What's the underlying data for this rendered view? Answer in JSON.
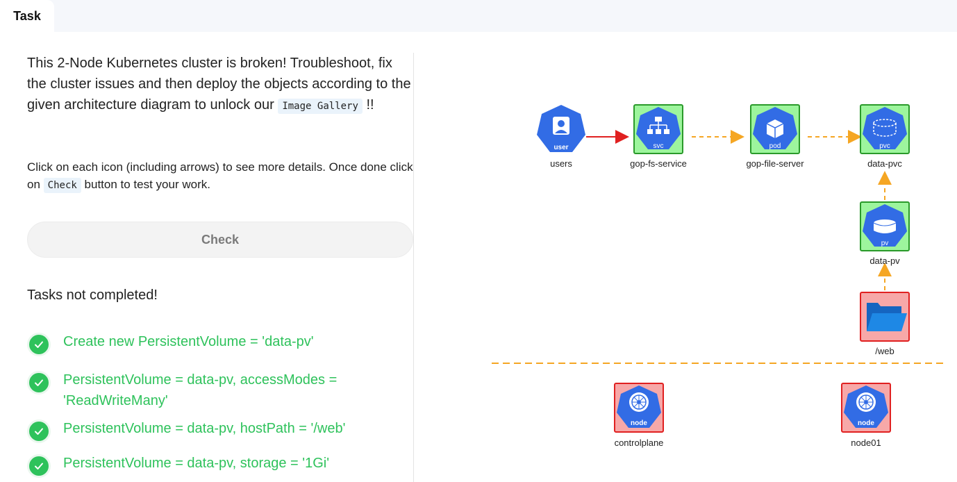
{
  "tab": {
    "label": "Task"
  },
  "intro": {
    "text": "This 2-Node Kubernetes cluster is broken! Troubleshoot, fix the cluster issues and then deploy the objects according to the given architecture diagram to unlock our",
    "code": "Image Gallery",
    "suffix": "!!"
  },
  "instructions": {
    "prefix": "Click on each icon (including arrows) to see more details. Once done click on",
    "code": "Check",
    "suffix": "button to test your work."
  },
  "check_button": {
    "label": "Check"
  },
  "status": {
    "text": "Tasks not completed!"
  },
  "tasks": [
    {
      "label": "Create new PersistentVolume = 'data-pv'",
      "done": true
    },
    {
      "label": "PersistentVolume = data-pv, accessModes = 'ReadWriteMany'",
      "done": true
    },
    {
      "label": "PersistentVolume = data-pv, hostPath = '/web'",
      "done": true
    },
    {
      "label": "PersistentVolume = data-pv, storage = '1Gi'",
      "done": true
    }
  ],
  "diagram": {
    "nodes": [
      {
        "id": "users",
        "label": "users",
        "badge": "user",
        "icon": "user-icon",
        "status": "none"
      },
      {
        "id": "svc",
        "label": "gop-fs-service",
        "badge": "svc",
        "icon": "service-icon",
        "status": "ok"
      },
      {
        "id": "pod",
        "label": "gop-file-server",
        "badge": "pod",
        "icon": "pod-icon",
        "status": "ok"
      },
      {
        "id": "pvc",
        "label": "data-pvc",
        "badge": "pvc",
        "icon": "pvc-icon",
        "status": "ok"
      },
      {
        "id": "pv",
        "label": "data-pv",
        "badge": "pv",
        "icon": "pv-icon",
        "status": "ok"
      },
      {
        "id": "web",
        "label": "/web",
        "badge": "",
        "icon": "folder-icon",
        "status": "error"
      },
      {
        "id": "controlplane",
        "label": "controlplane",
        "badge": "node",
        "icon": "node-icon",
        "status": "error"
      },
      {
        "id": "node01",
        "label": "node01",
        "badge": "node",
        "icon": "node-icon",
        "status": "error"
      }
    ],
    "colors": {
      "ok_bg": "#9df59d",
      "ok_border": "#2a9a2a",
      "err_bg": "#f7a8a8",
      "err_border": "#e02020",
      "k8s_blue": "#326ce5",
      "arrow_dashed": "#f5a623",
      "arrow_solid": "#e02020"
    }
  }
}
